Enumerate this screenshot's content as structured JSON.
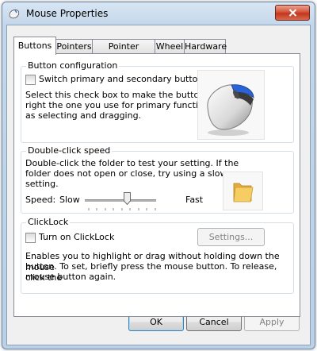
{
  "window": {
    "title": "Mouse Properties"
  },
  "tabs": [
    "Buttons",
    "Pointers",
    "Pointer Options",
    "Wheel",
    "Hardware"
  ],
  "button_config": {
    "title": "Button configuration",
    "checkbox_label": "Switch primary and secondary buttons",
    "checked": false,
    "desc_lines": [
      "Select this check box to make the button on the",
      "right the one you use for primary functions such",
      "as selecting and dragging."
    ]
  },
  "double_click": {
    "title": "Double-click speed",
    "desc_lines": [
      "Double-click the folder to test your setting.  If the",
      "folder does not open or close, try using a slower",
      "setting."
    ],
    "speed_label": "Speed:",
    "slow_label": "Slow",
    "fast_label": "Fast",
    "speed_level": 0.6
  },
  "clicklock": {
    "title": "ClickLock",
    "checkbox_label": "Turn on ClickLock",
    "checked": false,
    "settings_label": "Settings...",
    "desc_lines": [
      "Enables you to highlight or drag without holding down the mouse",
      "button.  To set, briefly press the mouse button.  To release, click the",
      "mouse button again."
    ]
  },
  "buttons": {
    "ok": "OK",
    "cancel": "Cancel",
    "apply": "Apply"
  },
  "icons": {
    "title": "mouse-icon",
    "close": "close-icon",
    "preview": "mouse-illustration",
    "folder": "folder-icon"
  },
  "colors": {
    "accent": "#3c7fb1",
    "close": "#c2351d",
    "folder": "#f2c14e"
  }
}
